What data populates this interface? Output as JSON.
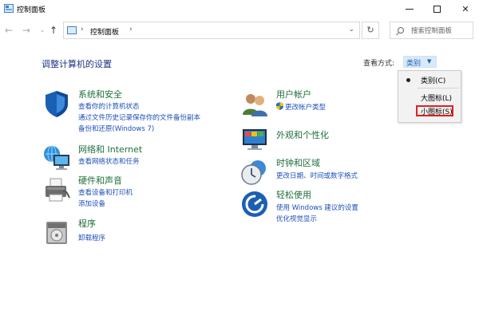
{
  "window": {
    "title": "控制面板"
  },
  "nav": {
    "breadcrumb": "控制面板",
    "search_placeholder": "搜索控制面板"
  },
  "header": {
    "title": "调整计算机的设置",
    "view_by_label": "查看方式:",
    "view_by_value": "类别"
  },
  "view_menu": {
    "items": [
      {
        "label": "类别(C)",
        "selected": true
      },
      {
        "label": "大图标(L)",
        "selected": false
      },
      {
        "label": "小图标(S)",
        "selected": false,
        "highlighted": true
      }
    ]
  },
  "categories": [
    {
      "icon": "shield-icon",
      "title": "系统和安全",
      "links": [
        "查看你的计算机状态",
        "通过文件历史记录保存你的文件备份副本",
        "备份和还原(Windows 7)"
      ]
    },
    {
      "icon": "network-icon",
      "title": "网络和 Internet",
      "links": [
        "查看网络状态和任务"
      ]
    },
    {
      "icon": "printer-icon",
      "title": "硬件和声音",
      "links": [
        "查看设备和打印机",
        "添加设备"
      ]
    },
    {
      "icon": "programs-icon",
      "title": "程序",
      "links": [
        "卸载程序"
      ]
    },
    {
      "icon": "users-icon",
      "title": "用户帐户",
      "links": [
        "更改帐户类型"
      ]
    },
    {
      "icon": "appearance-icon",
      "title": "外观和个性化",
      "links": []
    },
    {
      "icon": "clock-icon",
      "title": "时钟和区域",
      "links": [
        "更改日期、时间或数字格式"
      ]
    },
    {
      "icon": "ease-of-access-icon",
      "title": "轻松使用",
      "links": [
        "使用 Windows 建议的设置",
        "优化视觉显示"
      ]
    }
  ],
  "colors": {
    "heading": "#1e3287",
    "category_title": "#1e6e3a",
    "link": "#1d4fb8",
    "highlight_border": "#e02020",
    "view_selector_bg": "#d9e9f8"
  }
}
